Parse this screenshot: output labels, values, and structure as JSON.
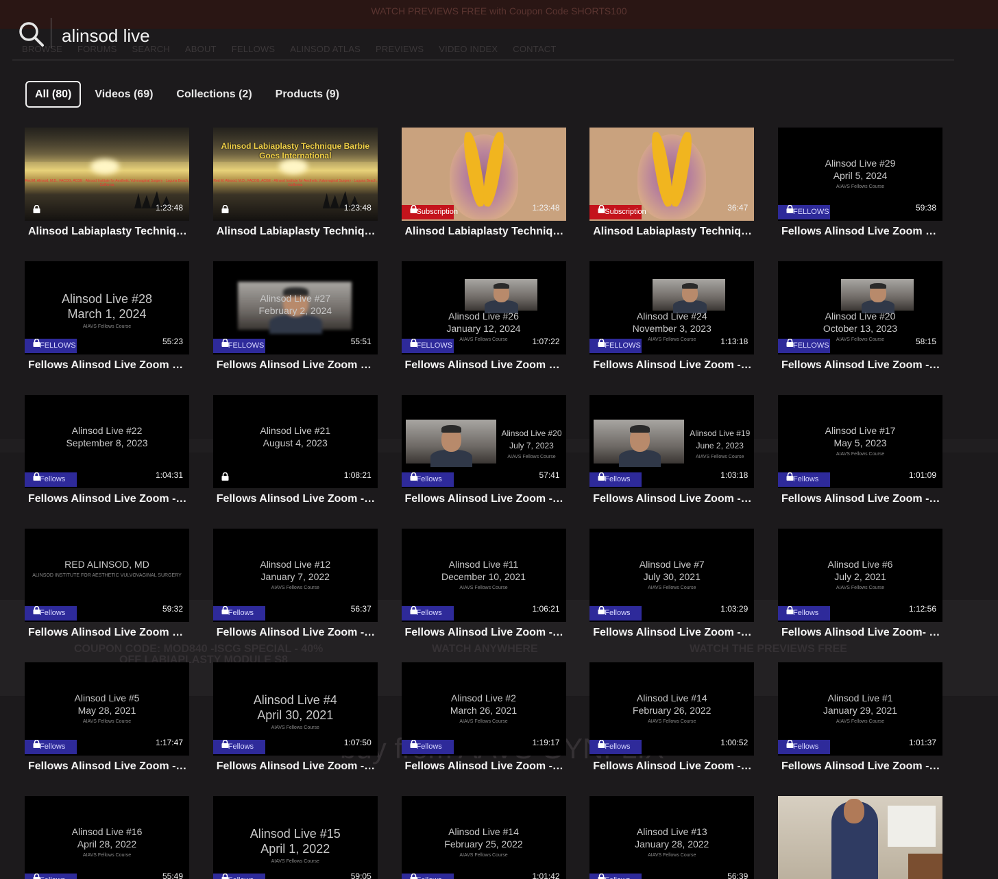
{
  "background": {
    "banner": "WATCH PREVIEWS FREE with Coupon Code SHORTS100",
    "nav": [
      "BROWSE",
      "FORUMS",
      "SEARCH",
      "ABOUT",
      "FELLOWS",
      "ALINSOD ATLAS",
      "PREVIEWS",
      "VIDEO INDEX",
      "CONTACT"
    ],
    "coupon": "COUPON CODE: MOD840 -ISCG SPECIAL - 40%",
    "coupon2": "OFF LABIAPLASTY MODULE S8",
    "watch_anywhere": "WATCH ANYWHERE",
    "watch_previews": "WATCH THE PREVIEWS FREE",
    "buy_from": "buy from AAVS GYNFLIX"
  },
  "search": {
    "value": "alinsod live"
  },
  "tabs": [
    {
      "label": "All (80)",
      "active": true
    },
    {
      "label": "Videos (69)",
      "active": false
    },
    {
      "label": "Collections (2)",
      "active": false
    },
    {
      "label": "Products (9)",
      "active": false
    }
  ],
  "badges": {
    "subscription": "Subscription",
    "fellows_caps": "FELLOWS",
    "fellows": "Fellows"
  },
  "cards": [
    {
      "title": "Alinsod Labiaplasty Techniqu...",
      "duration": "1:23:48",
      "art": "sunset",
      "overlay": "",
      "caption": "Red M. Alinsod, M.D., FACOG, ACGE · Alinsod Institute for Aesthetic Vulvovaginal Surgery · Laguna Beach, California"
    },
    {
      "title": "Alinsod Labiaplasty Techniqu...",
      "duration": "1:23:48",
      "art": "sunset",
      "overlay": "Alinsod Labiaplasty Technique Barbie Goes International",
      "caption": "Red M. Alinsod, M.D., FACOG, ACGE · Alinsod Institute for Aesthetic Vulvovaginal Surgery · Laguna Beach, California"
    },
    {
      "title": "Alinsod Labiaplasty Techniqu...",
      "duration": "1:23:48",
      "art": "anat",
      "badge": "subscription"
    },
    {
      "title": "Alinsod Labiaplasty Techniqu...",
      "duration": "36:47",
      "art": "anat",
      "badge": "subscription"
    },
    {
      "title": "Fellows Alinsod Live Zoom #...",
      "duration": "59:38",
      "art": "text",
      "line1": "Alinsod Live #29",
      "line2": "April 5, 2024",
      "sub": "AIAVS Fellows Course",
      "badge": "fellows_caps"
    },
    {
      "title": "Fellows Alinsod Live Zoom #...",
      "duration": "55:23",
      "art": "text",
      "line1": "Alinsod Live #28",
      "line2": "March 1, 2024",
      "sub": "AIAVS Fellows Course",
      "badge": "fellows_caps",
      "big": true
    },
    {
      "title": "Fellows Alinsod Live Zoom #...",
      "duration": "55:51",
      "art": "webcam-text",
      "line1": "Alinsod Live #27",
      "line2": "February 2, 2024",
      "badge": "fellows_caps"
    },
    {
      "title": "Fellows Alinsod Live Zoom #...",
      "duration": "1:07:22",
      "art": "webcam-text",
      "line1": "Alinsod Live #26",
      "line2": "January 12, 2024",
      "sub": "AIAVS Fellows Course",
      "badge": "fellows_caps"
    },
    {
      "title": "Fellows Alinsod Live Zoom - ...",
      "duration": "1:13:18",
      "art": "webcam-text",
      "line1": "Alinsod Live #24",
      "line2": "November 3, 2023",
      "sub": "AIAVS Fellows Course",
      "badge": "fellows_caps"
    },
    {
      "title": "Fellows Alinsod Live Zoom - ...",
      "duration": "58:15",
      "art": "webcam-text",
      "line1": "Alinsod Live #20",
      "line2": "October 13, 2023",
      "sub": "AIAVS Fellows Course",
      "badge": "fellows_caps"
    },
    {
      "title": "Fellows Alinsod Live Zoom - ...",
      "duration": "1:04:31",
      "art": "text",
      "line1": "Alinsod Live #22",
      "line2": "September 8, 2023",
      "badge": "fellows"
    },
    {
      "title": "Fellows Alinsod Live Zoom - ...",
      "duration": "1:08:21",
      "art": "text",
      "line1": "Alinsod Live #21",
      "line2": "August 4, 2023"
    },
    {
      "title": "Fellows Alinsod Live Zoom - ...",
      "duration": "57:41",
      "art": "webcam-side",
      "line1": "Alinsod Live #20",
      "line2": "July 7, 2023",
      "sub": "AIAVS Fellows Course",
      "badge": "fellows"
    },
    {
      "title": "Fellows Alinsod Live Zoom - ...",
      "duration": "1:03:18",
      "art": "webcam-side",
      "line1": "Alinsod Live #19",
      "line2": "June 2, 2023",
      "sub": "AIAVS Fellows Course",
      "badge": "fellows"
    },
    {
      "title": "Fellows Alinsod Live Zoom - ...",
      "duration": "1:01:09",
      "art": "text",
      "line1": "Alinsod Live #17",
      "line2": "May 5, 2023",
      "sub": "AIAVS Fellows Course",
      "badge": "fellows"
    },
    {
      "title": "Fellows Alinsod Live Zoom #...",
      "duration": "59:32",
      "art": "text",
      "line1": "RED ALINSOD, MD",
      "line2": "",
      "sub": "ALINSOD INSTITUTE FOR AESTHETIC VULVOVAGINAL SURGERY",
      "badge": "fellows"
    },
    {
      "title": "Fellows Alinsod Live Zoom - ...",
      "duration": "56:37",
      "art": "text",
      "line1": "Alinsod Live #12",
      "line2": "January 7, 2022",
      "sub": "AIAVS Fellows Course",
      "badge": "fellows"
    },
    {
      "title": "Fellows Alinsod Live Zoom - ...",
      "duration": "1:06:21",
      "art": "text",
      "line1": "Alinsod Live #11",
      "line2": "December 10, 2021",
      "sub": "AIAVS Fellows Course",
      "badge": "fellows"
    },
    {
      "title": "Fellows Alinsod Live Zoom - ...",
      "duration": "1:03:29",
      "art": "text",
      "line1": "Alinsod Live #7",
      "line2": "July 30, 2021",
      "sub": "AIAVS Fellows Course",
      "badge": "fellows"
    },
    {
      "title": "Fellows Alinsod Live Zoom- J...",
      "duration": "1:12:56",
      "art": "text",
      "line1": "Alinsod Live #6",
      "line2": "July 2, 2021",
      "sub": "AIAVS Fellows Course",
      "badge": "fellows"
    },
    {
      "title": "Fellows Alinsod Live Zoom - ...",
      "duration": "1:17:47",
      "art": "text",
      "line1": "Alinsod Live #5",
      "line2": "May 28, 2021",
      "sub": "AIAVS Fellows Course",
      "badge": "fellows"
    },
    {
      "title": "Fellows Alinsod Live Zoom - ...",
      "duration": "1:07:50",
      "art": "text",
      "line1": "Alinsod Live #4",
      "line2": "April 30, 2021",
      "sub": "AIAVS Fellows Course",
      "badge": "fellows",
      "big": true
    },
    {
      "title": "Fellows Alinsod Live Zoom - ...",
      "duration": "1:19:17",
      "art": "text",
      "line1": "Alinsod Live #2",
      "line2": "March 26, 2021",
      "sub": "AIAVS Fellows Course",
      "badge": "fellows"
    },
    {
      "title": "Fellows Alinsod Live Zoom - ...",
      "duration": "1:00:52",
      "art": "text",
      "line1": "Alinsod Live #14",
      "line2": "February 26, 2022",
      "sub": "AIAVS Fellows Course",
      "badge": "fellows"
    },
    {
      "title": "Fellows Alinsod Live Zoom - ...",
      "duration": "1:01:37",
      "art": "text",
      "line1": "Alinsod Live #1",
      "line2": "January 29, 2021",
      "sub": "AIAVS Fellows Course",
      "badge": "fellows"
    },
    {
      "title": "",
      "duration": "55:49",
      "art": "text",
      "line1": "Alinsod Live #16",
      "line2": "April 28, 2022",
      "sub": "AIAVS Fellows Course",
      "badge": "fellows"
    },
    {
      "title": "",
      "duration": "59:05",
      "art": "text",
      "line1": "Alinsod Live #15",
      "line2": "April 1, 2022",
      "sub": "AIAVS Fellows Course",
      "badge": "fellows",
      "big": true
    },
    {
      "title": "",
      "duration": "1:01:42",
      "art": "text",
      "line1": "Alinsod Live #14",
      "line2": "February 25, 2022",
      "sub": "AIAVS Fellows Course",
      "badge": "fellows"
    },
    {
      "title": "",
      "duration": "56:39",
      "art": "text",
      "line1": "Alinsod Live #13",
      "line2": "January 28, 2022",
      "sub": "AIAVS Fellows Course",
      "badge": "fellows"
    },
    {
      "title": "",
      "duration": "",
      "art": "photo"
    }
  ]
}
